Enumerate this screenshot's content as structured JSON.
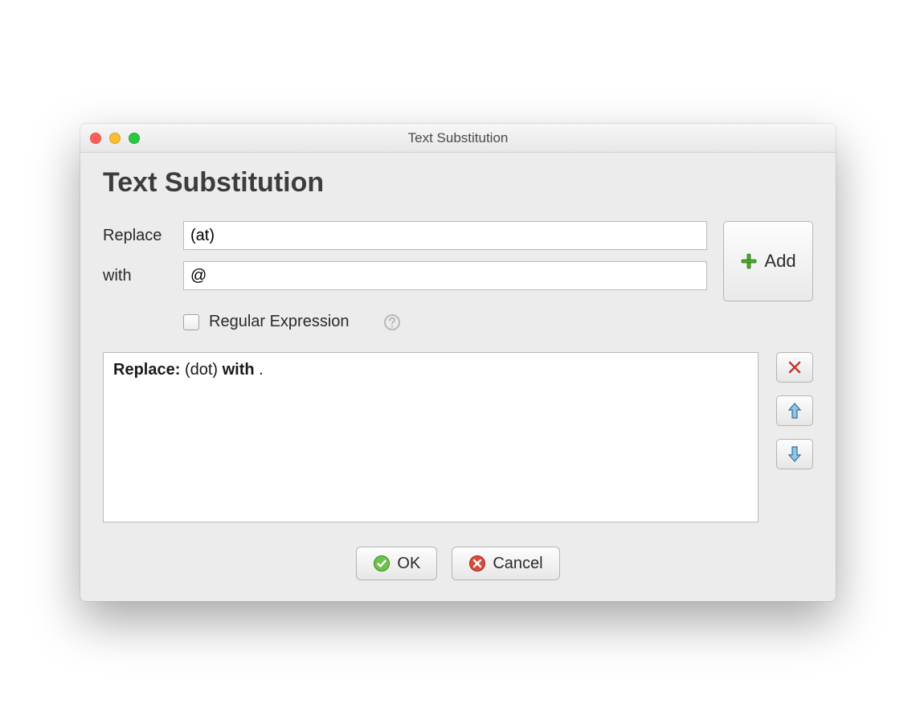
{
  "window": {
    "title": "Text Substitution"
  },
  "header": {
    "title": "Text Substitution"
  },
  "form": {
    "replace_label": "Replace",
    "replace_value": "(at)",
    "with_label": "with",
    "with_value": "@",
    "add_label": "Add",
    "regex_label": "Regular Expression",
    "regex_checked": false
  },
  "rules": [
    {
      "prefix": "Replace:",
      "find": "(dot)",
      "mid": "with",
      "replace": "."
    }
  ],
  "footer": {
    "ok_label": "OK",
    "cancel_label": "Cancel"
  }
}
